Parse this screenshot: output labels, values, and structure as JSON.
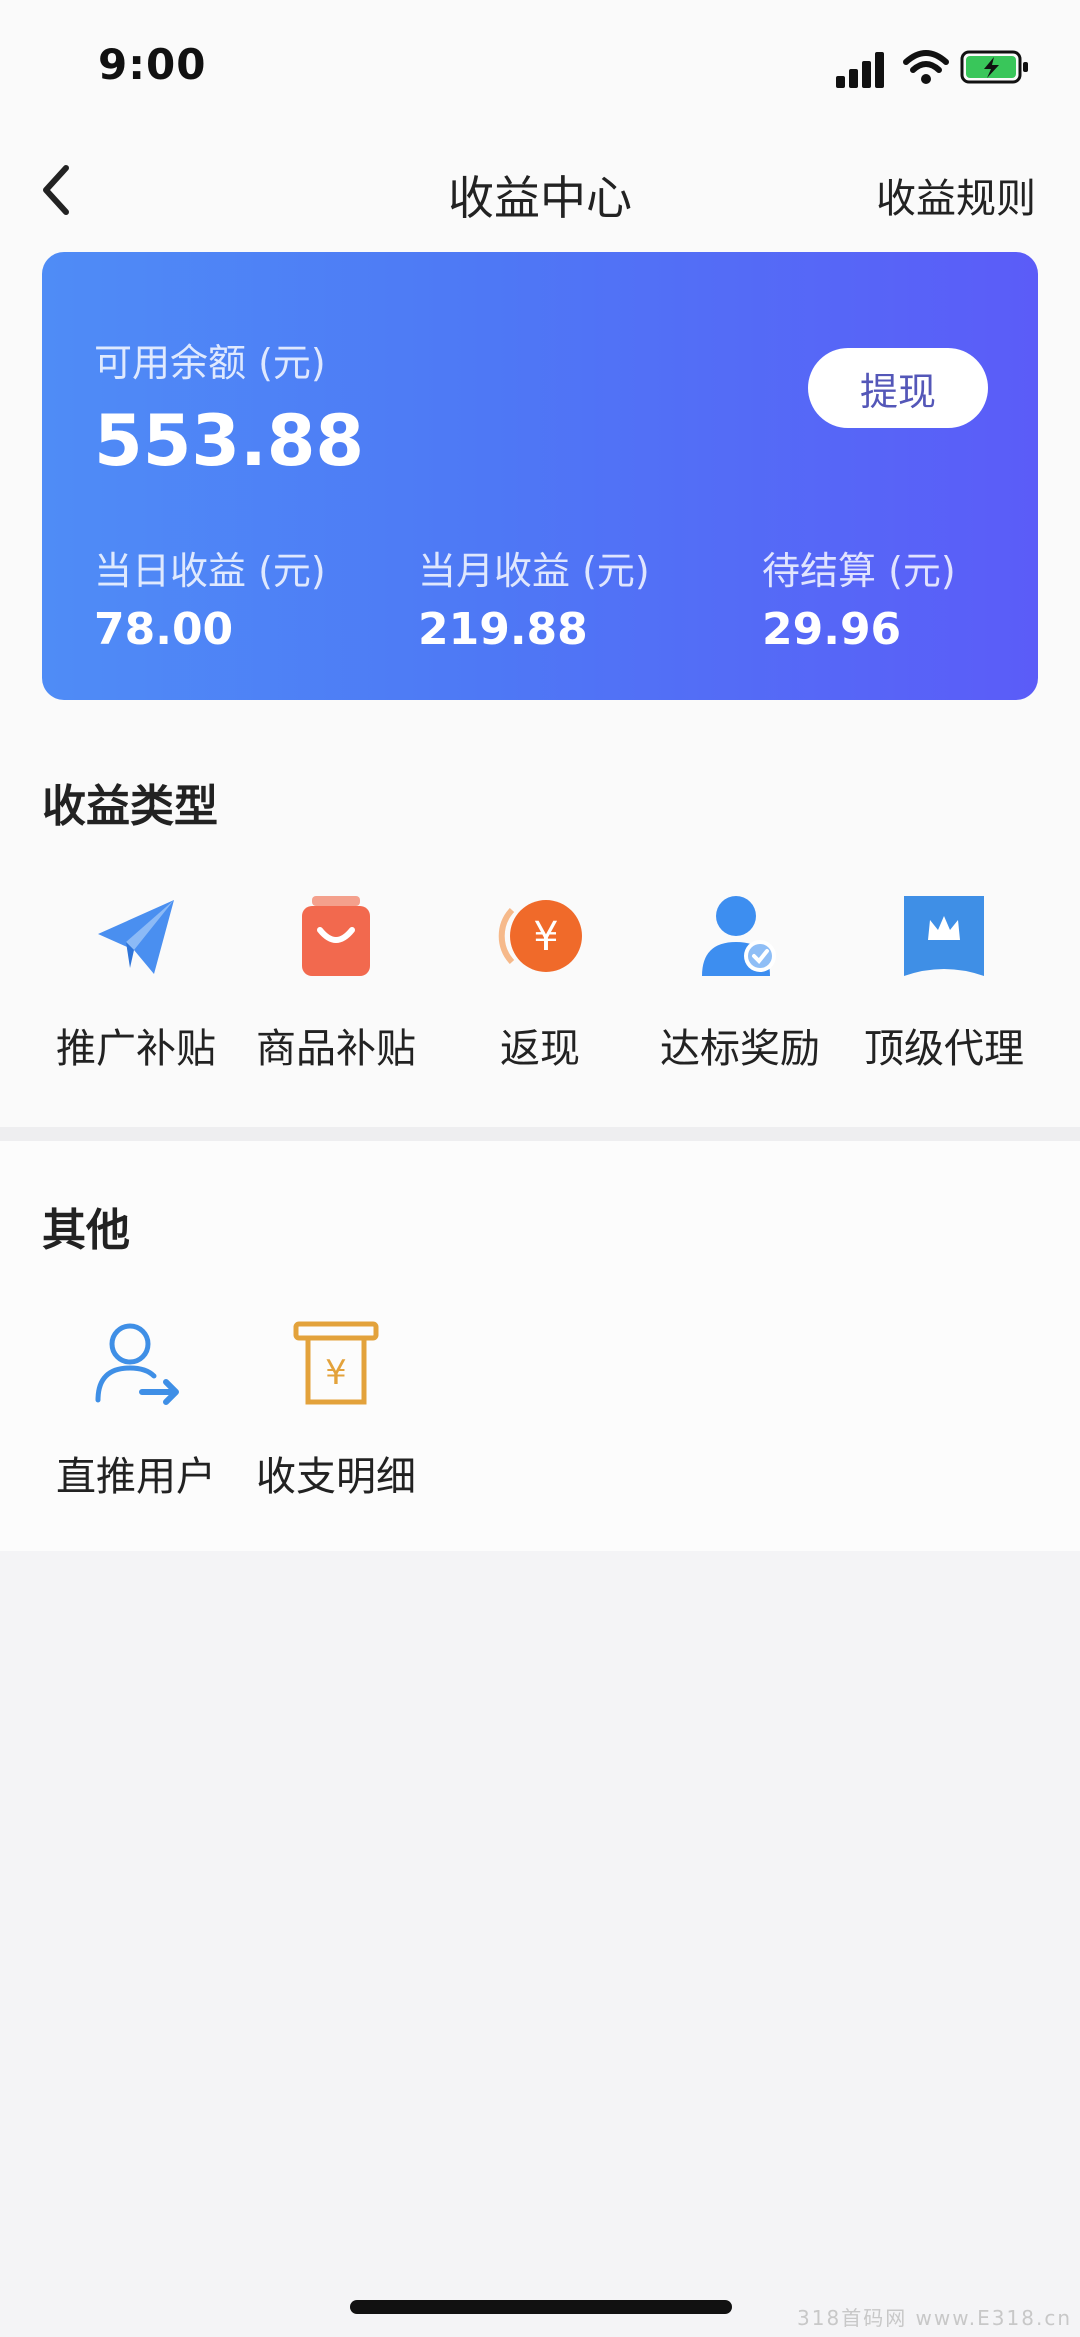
{
  "status_bar": {
    "time": "9:00"
  },
  "nav": {
    "title": "收益中心",
    "rules_link": "收益规则"
  },
  "balance_card": {
    "available_label": "可用余额 (元)",
    "available_amount": "553.88",
    "withdraw_label": "提现",
    "stats": [
      {
        "label": "当日收益 (元)",
        "value": "78.00"
      },
      {
        "label": "当月收益 (元)",
        "value": "219.88"
      },
      {
        "label": "待结算 (元)",
        "value": "29.96"
      }
    ],
    "gradient_colors": [
      "#4f8cf6",
      "#5b5cf8"
    ]
  },
  "income_types": {
    "title": "收益类型",
    "items": [
      {
        "label": "推广补贴",
        "icon": "paper-plane-icon",
        "color": "#4a8ff0"
      },
      {
        "label": "商品补贴",
        "icon": "shopping-bag-icon",
        "color": "#f2694e"
      },
      {
        "label": "返现",
        "icon": "yen-coin-icon",
        "color": "#f06a2a"
      },
      {
        "label": "达标奖励",
        "icon": "user-check-icon",
        "color": "#3d8ef0"
      },
      {
        "label": "顶级代理",
        "icon": "crown-flag-icon",
        "color": "#3f8fe6"
      }
    ]
  },
  "others": {
    "title": "其他",
    "items": [
      {
        "label": "直推用户",
        "icon": "user-transfer-icon",
        "color": "#3f8fe6"
      },
      {
        "label": "收支明细",
        "icon": "yen-receipt-icon",
        "color": "#e3a23b"
      }
    ]
  },
  "watermark": "318首码网 www.E318.cn"
}
